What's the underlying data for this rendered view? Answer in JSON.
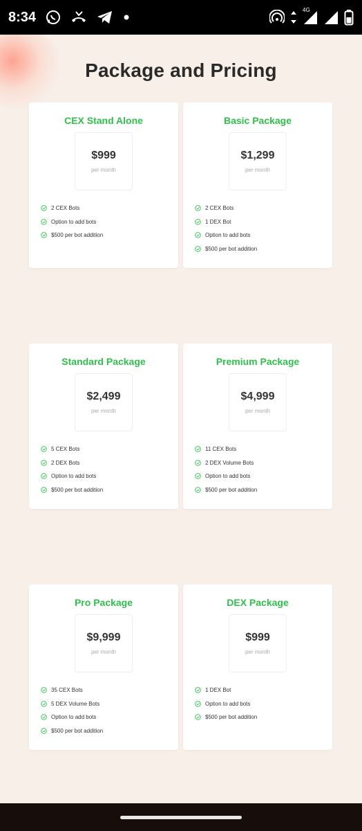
{
  "status": {
    "time": "8:34",
    "network": "4G"
  },
  "page": {
    "title": "Package and Pricing"
  },
  "packages": [
    {
      "name": "CEX Stand Alone",
      "price": "$999",
      "period": "per month",
      "features": [
        "2 CEX Bots",
        "Option to add bots",
        "$500 per bot addition"
      ]
    },
    {
      "name": "Basic Package",
      "price": "$1,299",
      "period": "per month",
      "features": [
        "2 CEX Bots",
        "1 DEX Bot",
        "Option to add bots",
        "$500 per bot addition"
      ]
    },
    {
      "name": "Standard Package",
      "price": "$2,499",
      "period": "per month",
      "features": [
        "5 CEX Bots",
        "2 DEX Bots",
        "Option to add bots",
        "$500 per bot addition"
      ]
    },
    {
      "name": "Premium Package",
      "price": "$4,999",
      "period": "per month",
      "features": [
        "11 CEX Bots",
        "2 DEX Volume Bots",
        "Option to add bots",
        "$500 per bot addition"
      ]
    },
    {
      "name": "Pro Package",
      "price": "$9,999",
      "period": "per month",
      "features": [
        "35 CEX Bots",
        "5 DEX Volume Bots",
        "Option to add bots",
        "$500 per bot addition"
      ]
    },
    {
      "name": "DEX Package",
      "price": "$999",
      "period": "per month",
      "features": [
        "1 DEX Bot",
        "Option to add bots",
        "$500 per bot addition"
      ]
    }
  ],
  "colors": {
    "accent": "#2fbf4b",
    "background": "#f8efe9"
  }
}
